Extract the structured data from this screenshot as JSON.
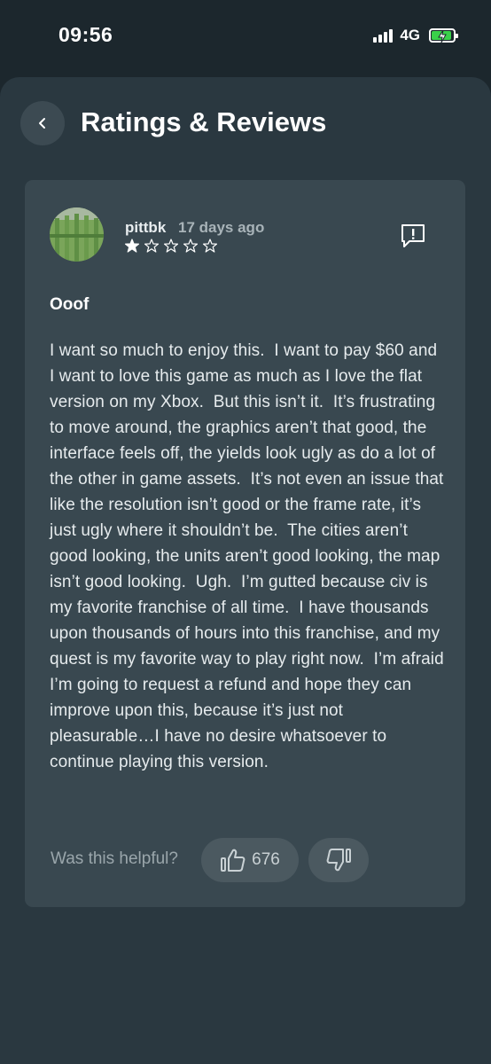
{
  "status_bar": {
    "time": "09:56",
    "network": "4G",
    "battery_level": 0.9,
    "battery_color": "#3ad04a"
  },
  "header": {
    "title": "Ratings & Reviews",
    "back_icon": "chevron-left-icon"
  },
  "review": {
    "reviewer": "pittbk",
    "date": "17 days ago",
    "rating": 1,
    "max_rating": 5,
    "report_icon": "report-icon",
    "title": "Ooof",
    "body": "I want so much to enjoy this.  I want to pay $60 and I want to love this game as much as I love the flat version on my Xbox.  But this isn’t it.  It’s frustrating to move around, the graphics aren’t that good, the interface feels off, the yields look ugly as do a lot of the other in game assets.  It’s not even an issue that like the resolution isn’t good or the frame rate, it’s just ugly where it shouldn’t be.  The cities aren’t good looking, the units aren’t good looking, the map isn’t good looking.  Ugh.  I’m gutted because civ is my favorite franchise of all time.  I have thousands upon thousands of hours into this franchise, and my quest is my favorite way to play right now.  I’m afraid I’m going to request a refund and hope they can improve upon this, because it’s just not pleasurable…I have no desire whatsoever to continue playing this version.",
    "helpful_label": "Was this helpful?",
    "upvote_count": "676",
    "upvote_icon": "thumbs-up-icon",
    "downvote_icon": "thumbs-down-icon"
  }
}
